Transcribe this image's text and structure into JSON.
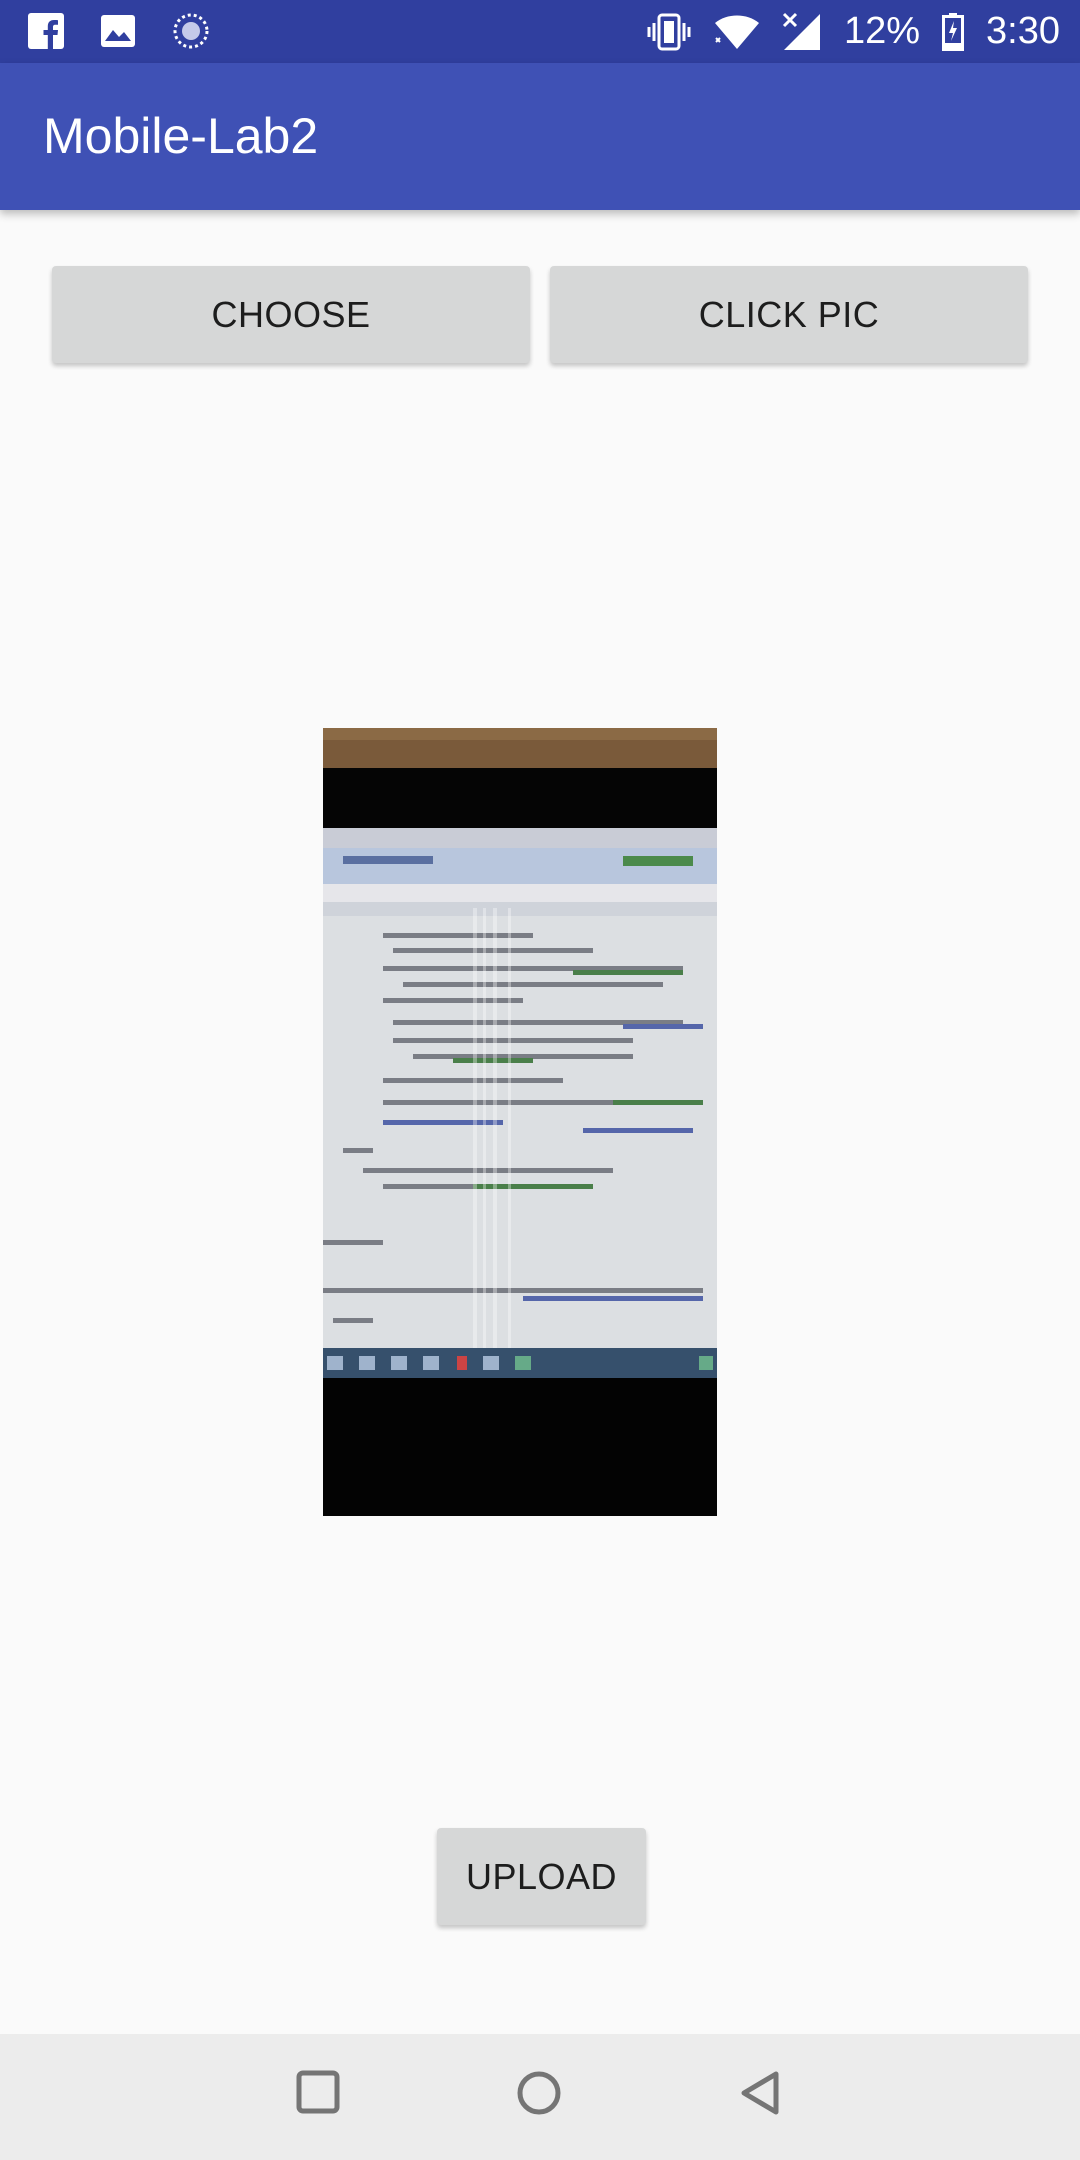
{
  "status_bar": {
    "battery_percent": "12%",
    "time": "3:30",
    "icons": [
      "facebook-icon",
      "gallery-icon",
      "sync-icon",
      "vibrate-icon",
      "wifi-icon",
      "signal-off-icon",
      "battery-low-icon"
    ]
  },
  "app_bar": {
    "title": "Mobile-Lab2"
  },
  "actions": {
    "choose_label": "CHOOSE",
    "click_pic_label": "CLICK PIC",
    "upload_label": "UPLOAD"
  },
  "colors": {
    "status_bar": "#303f9f",
    "app_bar": "#3f51b5",
    "button": "#d6d7d7",
    "background": "#fafafa",
    "nav_bar": "#ececec"
  },
  "nav_bar": {
    "buttons": [
      "recent-apps-icon",
      "home-icon",
      "back-icon"
    ]
  }
}
